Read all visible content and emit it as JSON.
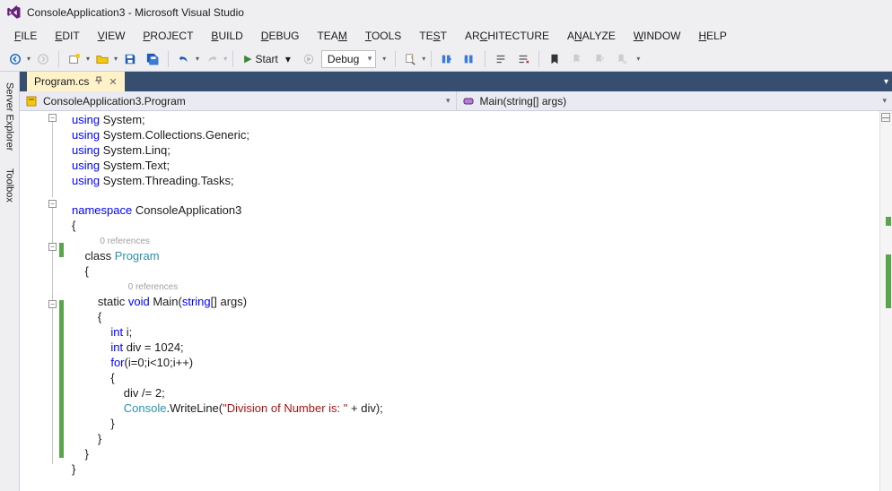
{
  "title": "ConsoleApplication3 - Microsoft Visual Studio",
  "menu": {
    "file": "FILE",
    "edit": "EDIT",
    "view": "VIEW",
    "project": "PROJECT",
    "build": "BUILD",
    "debug": "DEBUG",
    "team": "TEAM",
    "tools": "TOOLS",
    "test": "TEST",
    "architecture": "ARCHITECTURE",
    "analyze": "ANALYZE",
    "window": "WINDOW",
    "help": "HELP"
  },
  "toolbar": {
    "start": "Start",
    "config": "Debug"
  },
  "side": {
    "server": "Server Explorer",
    "toolbox": "Toolbox"
  },
  "tab": {
    "filename": "Program.cs"
  },
  "nav": {
    "scope": "ConsoleApplication3.Program",
    "member": "Main(string[] args)"
  },
  "refs": {
    "zero": "0 references"
  },
  "code": {
    "l1a": "using",
    "l1b": " System;",
    "l2a": "using",
    "l2b": " System.Collections.Generic;",
    "l3a": "using",
    "l3b": " System.Linq;",
    "l4a": "using",
    "l4b": " System.Text;",
    "l5a": "using",
    "l5b": " System.Threading.Tasks;",
    "l7a": "namespace",
    "l7b": " ConsoleApplication3",
    "l8": "{",
    "l10a": "    class ",
    "l10b": "Program",
    "l11": "    {",
    "l13a": "        static ",
    "l13b": "void",
    "l13c": " Main(",
    "l13d": "string",
    "l13e": "[] args)",
    "l14": "        {",
    "l15a": "            int",
    "l15b": " i;",
    "l16a": "            int",
    "l16b": " div = 1024;",
    "l17a": "            for",
    "l17b": "(i=0;i<10;i++)",
    "l18": "            {",
    "l19": "                div /= 2;",
    "l20a": "                Console",
    "l20b": ".WriteLine(",
    "l20c": "\"Division of Number is: \"",
    "l20d": " + div);",
    "l21": "            }",
    "l22": "        }",
    "l23": "    }",
    "l24": "}"
  }
}
